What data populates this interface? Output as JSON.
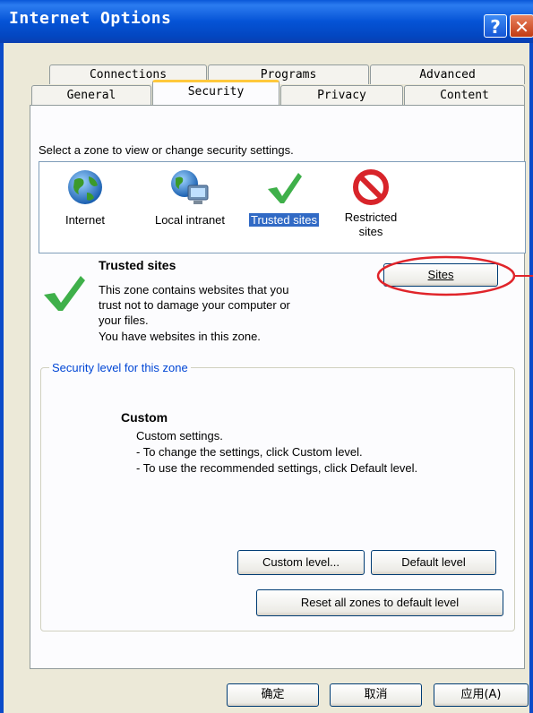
{
  "window": {
    "title": "Internet Options",
    "help_label": "?",
    "close_label": "✕"
  },
  "tabs_row1": [
    "Connections",
    "Programs",
    "Advanced"
  ],
  "tabs_row2": [
    "General",
    "Security",
    "Privacy",
    "Content"
  ],
  "prompt": "Select a zone to view or change security settings.",
  "zones": [
    {
      "label": "Internet",
      "icon": "globe-icon"
    },
    {
      "label": "Local intranet",
      "icon": "intranet-icon"
    },
    {
      "label": "Trusted sites",
      "icon": "checkmark-icon",
      "selected": true
    },
    {
      "label": "Restricted\nsites",
      "icon": "prohibited-icon"
    }
  ],
  "zone_info": {
    "title": "Trusted sites",
    "desc": [
      "This zone contains websites that you",
      "trust not to damage your computer or",
      "your files.",
      "You have websites in this zone."
    ],
    "sites_button": "Sites"
  },
  "security_level": {
    "group_label": "Security level for this zone",
    "title": "Custom",
    "lines": [
      "Custom settings.",
      "- To change the settings, click Custom level.",
      "- To use the recommended settings, click Default level."
    ],
    "custom_button": "Custom level...",
    "default_button": "Default level"
  },
  "reset_button": "Reset all zones to default level",
  "buttons": {
    "ok": "确定",
    "cancel": "取消",
    "apply": "应用(A)"
  },
  "colors": {
    "titlebar": "#0553d6",
    "selection": "#316ac5",
    "annotation": "#e0242a",
    "group_label": "#0046d5"
  }
}
